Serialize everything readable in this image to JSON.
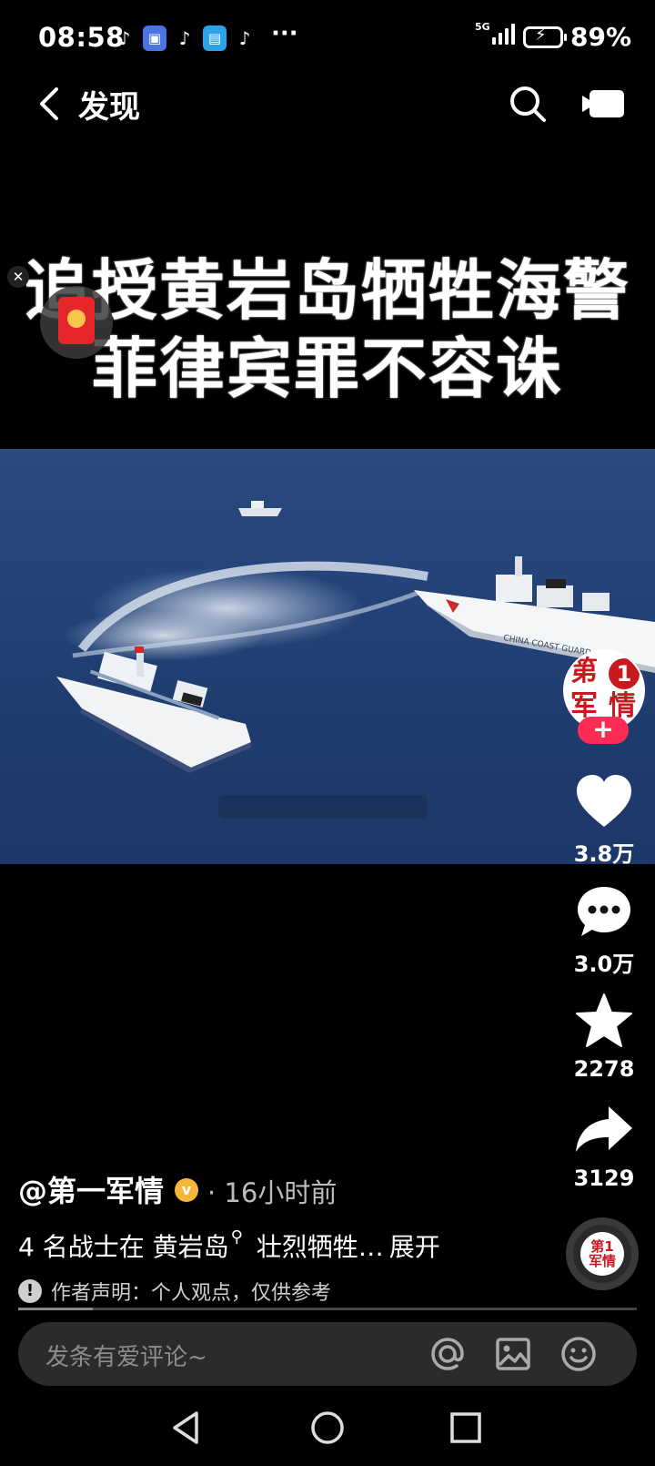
{
  "status_bar": {
    "time": "08:58",
    "notif_dots": "···",
    "network": "5G",
    "battery": "89%"
  },
  "header": {
    "title": "发现"
  },
  "video": {
    "headline_line1": "追授黄岩岛牺牲海警",
    "headline_line2": "菲律宾罪不容诛",
    "ship_text": "CHINA COAST GUARD"
  },
  "rail": {
    "avatar_text": "第一军情",
    "follow": "+",
    "likes": "3.8万",
    "comments": "3.0万",
    "favorites": "2278",
    "shares": "3129"
  },
  "post": {
    "author": "@第一军情",
    "verified_mark": "v",
    "time": "· 16小时前",
    "desc_prefix": "4 名战士在",
    "desc_link": "黄岩岛",
    "desc_suffix": "壮烈牺牲…",
    "expand": "展开",
    "disclaimer": "作者声明：个人观点，仅供参考",
    "progress_fraction": 0.12
  },
  "comment": {
    "placeholder": "发条有爱评论~"
  },
  "colors": {
    "accent": "#fe2c55",
    "verified": "#f5b63b",
    "brand_red": "#c8191f"
  },
  "icons": [
    "back-icon",
    "search-icon",
    "camera-icon",
    "heart-icon",
    "comment-icon",
    "star-icon",
    "share-icon",
    "at-icon",
    "image-icon",
    "emoji-icon",
    "nav-back-icon",
    "nav-home-icon",
    "nav-recents-icon"
  ]
}
